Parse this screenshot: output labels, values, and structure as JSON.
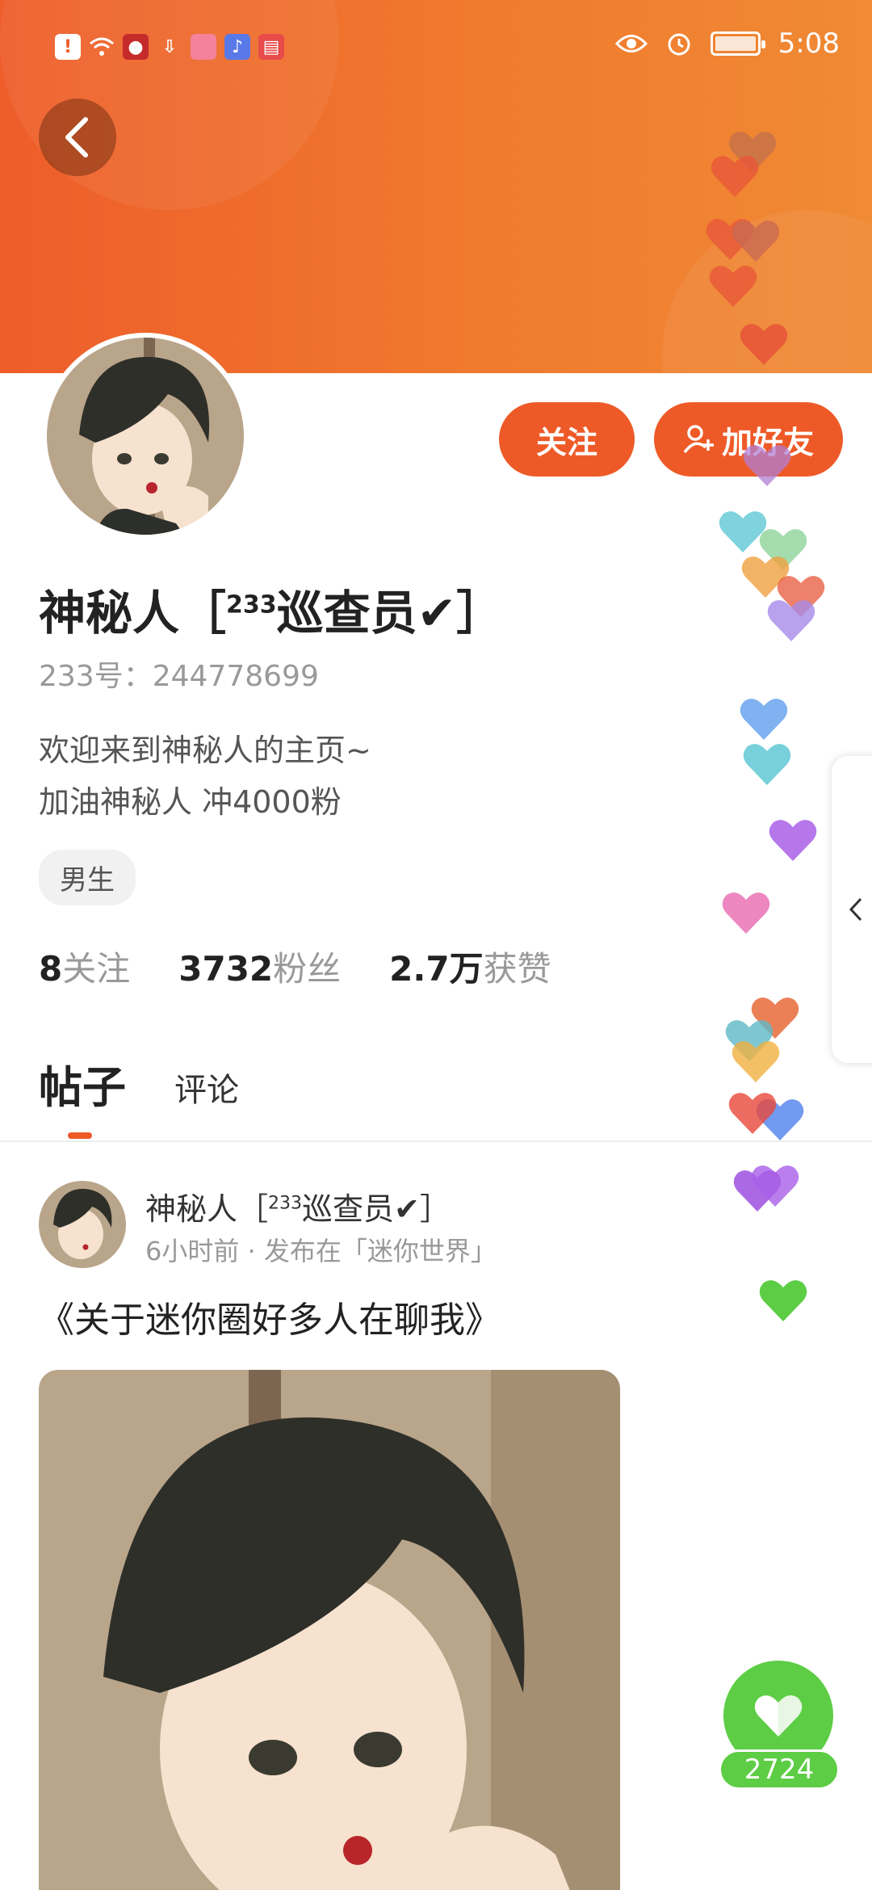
{
  "status_bar": {
    "time": "5:08"
  },
  "profile": {
    "name_prefix": "神秘人［",
    "name_sup": "233",
    "name_suffix": "巡查员✔］",
    "id_text": "233号：244778699",
    "bio_line1": "欢迎来到神秘人的主页~",
    "bio_line2": "加油神秘人 冲4000粉",
    "gender_tag": "男生"
  },
  "actions": {
    "follow_label": "关注",
    "add_friend_label": "加好友"
  },
  "stats": [
    {
      "num": "8",
      "label": "关注"
    },
    {
      "num": "3732",
      "label": "粉丝"
    },
    {
      "num": "2.7万",
      "label": "获赞"
    }
  ],
  "tabs": {
    "posts": "帖子",
    "comments": "评论"
  },
  "post": {
    "author_prefix": "神秘人［",
    "author_sup": "233",
    "author_suffix": "巡查员✔］",
    "meta": "6小时前 · 发布在「迷你世界」",
    "title": "《关于迷你圈好多人在聊我》"
  },
  "like": {
    "count": "2724"
  },
  "colors": {
    "accent": "#ee5a27",
    "like_green": "#5ccd44"
  },
  "icons": [
    "back-icon",
    "add-user-icon",
    "chevron-left-icon",
    "heart-icon"
  ]
}
